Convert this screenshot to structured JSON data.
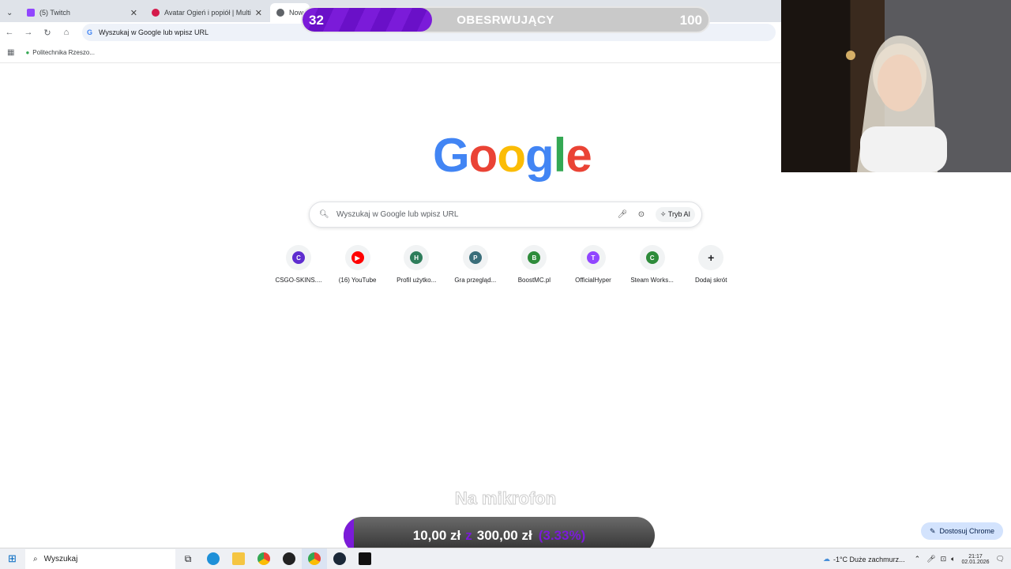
{
  "browser": {
    "tabs": [
      {
        "label": "(5) Twitch",
        "icon": "twitch-icon",
        "color": "#9146ff"
      },
      {
        "label": "Avatar Ogień i popiół | Multikin",
        "icon": "multikino-icon",
        "color": "#d41a4b"
      },
      {
        "label": "Now",
        "icon": "chrome-icon",
        "color": "#5f6368"
      }
    ],
    "omnibox_text": "Wyszukaj w Google lub wpisz URL",
    "bookmark": "Politechnika Rzeszo..."
  },
  "newtab": {
    "logo": "Google",
    "search_placeholder": "Wyszukaj w Google lub wpisz URL",
    "ai_mode": "Tryb AI",
    "shortcuts": [
      {
        "label": "CSGO-SKINS....",
        "letter": "C",
        "color": "#5e2ccf"
      },
      {
        "label": "(16) YouTube",
        "letter": "▶",
        "color": "#ff0000"
      },
      {
        "label": "Profil użytko...",
        "letter": "H",
        "color": "#2e7d5b"
      },
      {
        "label": "Gra przegląd...",
        "letter": "P",
        "color": "#3a6e7a"
      },
      {
        "label": "BoostMC.pl",
        "letter": "B",
        "color": "#2e8b3a"
      },
      {
        "label": "OfficialHyper",
        "letter": "T",
        "color": "#9146ff"
      },
      {
        "label": "Steam Works...",
        "letter": "C",
        "color": "#2e8b3a"
      },
      {
        "label": "Dodaj skrót",
        "letter": "+",
        "color": "#f1f3f4"
      }
    ],
    "customize": "Dostosuj Chrome"
  },
  "overlay": {
    "followers_current": "32",
    "followers_label": "OBESRWUJĄCY",
    "followers_goal": "100",
    "followers_fraction": 0.32,
    "caption": "Na mikrofon",
    "donation_current": "10,00 zł",
    "donation_sep": "z",
    "donation_goal": "300,00 zł",
    "donation_percent": "(3.33%)",
    "donation_fraction": 0.0333
  },
  "taskbar": {
    "search": "Wyszukaj",
    "weather": "-1°C Duże zachmurz...",
    "time": "21:17",
    "date": "02.01.2026"
  }
}
